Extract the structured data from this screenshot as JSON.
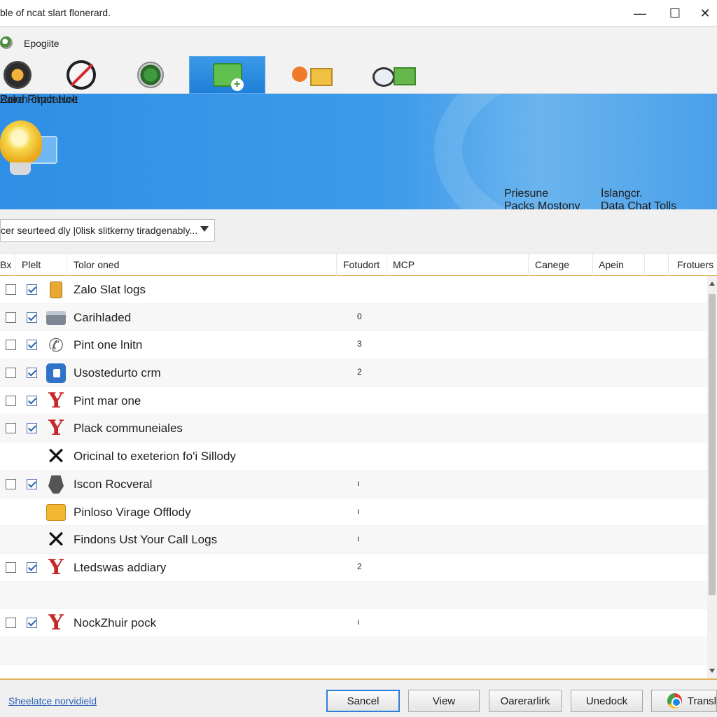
{
  "window": {
    "title": "ble of ncat slart flonerard."
  },
  "app": {
    "name": "Epogiite"
  },
  "toolbar": {
    "items": [
      {
        "icon": "compass-icon"
      },
      {
        "icon": "no-sign-icon"
      },
      {
        "icon": "globe-search-icon"
      },
      {
        "icon": "folder-add-icon",
        "active": true
      },
      {
        "icon": "paint-image-icon"
      },
      {
        "icon": "monitor-chart-icon"
      }
    ]
  },
  "banner": {
    "title": "Zalon ĉhalt Holt",
    "subtitle": "Rord Fnpcature",
    "features": [
      {
        "line1": "Priesune",
        "line2": "Packs Mostony"
      },
      {
        "line1": "Ìslangcr.",
        "line2": "Data Chat Tolls"
      }
    ]
  },
  "filter": {
    "value": "cer seurteed dly |0lisk slitkerny tiradgenably..."
  },
  "table": {
    "columns": [
      "Bx",
      "Plelt",
      "Tolor oned",
      "Fotudort",
      "MCP",
      "Canege",
      "Apein",
      "Frotuers"
    ],
    "rows": [
      {
        "c1": true,
        "c2": true,
        "icon": "lock",
        "label": "Zalo Slat logs",
        "value": ""
      },
      {
        "c1": true,
        "c2": true,
        "icon": "printer",
        "label": "Carihladed",
        "value": "0"
      },
      {
        "c1": true,
        "c2": true,
        "icon": "phone",
        "label": "Pint one lnitn",
        "value": "3"
      },
      {
        "c1": true,
        "c2": true,
        "icon": "app",
        "label": "Usostedurto crm",
        "value": "2"
      },
      {
        "c1": true,
        "c2": true,
        "icon": "y",
        "label": "Pint mar one",
        "value": ""
      },
      {
        "c1": true,
        "c2": true,
        "icon": "y",
        "label": "Plack communeiales",
        "value": ""
      },
      {
        "c1": false,
        "c2": false,
        "icon": "x",
        "label": "Oricinal to exeterion fo'i Sillody",
        "value": ""
      },
      {
        "c1": true,
        "c2": true,
        "icon": "tool",
        "label": "Iscon Rocveral",
        "value": "ı"
      },
      {
        "c1": false,
        "c2": false,
        "icon": "folder",
        "label": "Pinloso Virage Offlody",
        "value": "ı"
      },
      {
        "c1": false,
        "c2": false,
        "icon": "x",
        "label": "Findons Ust Your Call Logs",
        "value": "ı"
      },
      {
        "c1": true,
        "c2": true,
        "icon": "y",
        "label": "Ltedswas addiary",
        "value": "2"
      },
      {
        "c1": false,
        "c2": false,
        "icon": "",
        "label": "",
        "value": ""
      },
      {
        "c1": true,
        "c2": true,
        "icon": "y",
        "label": "NockZhuir pock",
        "value": "ı"
      },
      {
        "c1": false,
        "c2": false,
        "icon": "",
        "label": "",
        "value": ""
      }
    ]
  },
  "footer": {
    "link": "Sheelatce norvidield",
    "buttons": [
      "Sancel",
      "View",
      "Oarerarlirk",
      "Unedock",
      "Transl"
    ]
  },
  "colors": {
    "banner": "#2f8fe6",
    "accent": "#2f7fd8",
    "check": "#2a5db0",
    "header_rule": "#e1b65a"
  }
}
